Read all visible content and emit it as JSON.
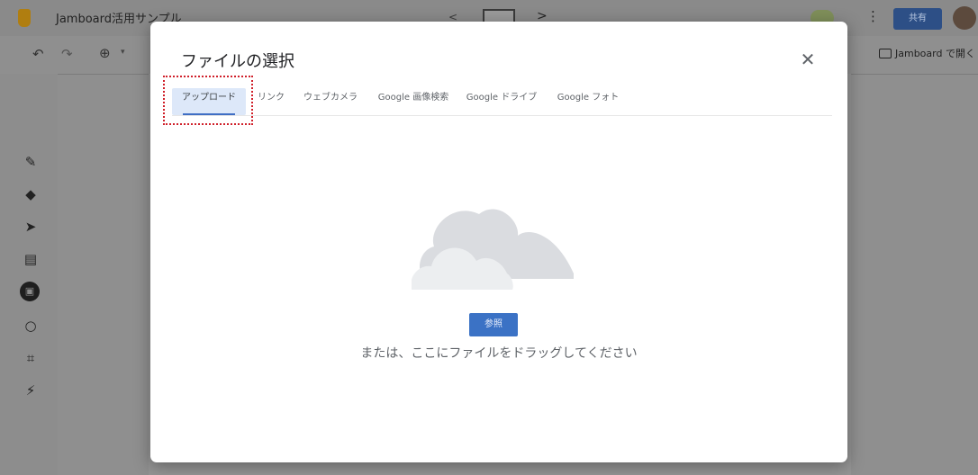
{
  "app": {
    "title": "Jamboard活用サンプル",
    "share_label": "共有",
    "open_in_jamboard": "Jamboard で開く"
  },
  "dialog": {
    "title": "ファイルの選択",
    "tabs": [
      {
        "label": "アップロード",
        "active": true
      },
      {
        "label": "リンク"
      },
      {
        "label": "ウェブカメラ"
      },
      {
        "label": "Google 画像検索"
      },
      {
        "label": "Google ドライブ"
      },
      {
        "label": "Google フォト"
      }
    ],
    "browse_label": "参照",
    "drop_text": "または、ここにファイルをドラッグしてください",
    "accent_color": "#3b72c5",
    "highlight_color": "#d0202a"
  },
  "icons": {
    "undo": "undo-icon",
    "redo": "redo-icon",
    "zoom": "zoom-icon",
    "close": "close-icon",
    "cloud": "cloud-icon"
  }
}
